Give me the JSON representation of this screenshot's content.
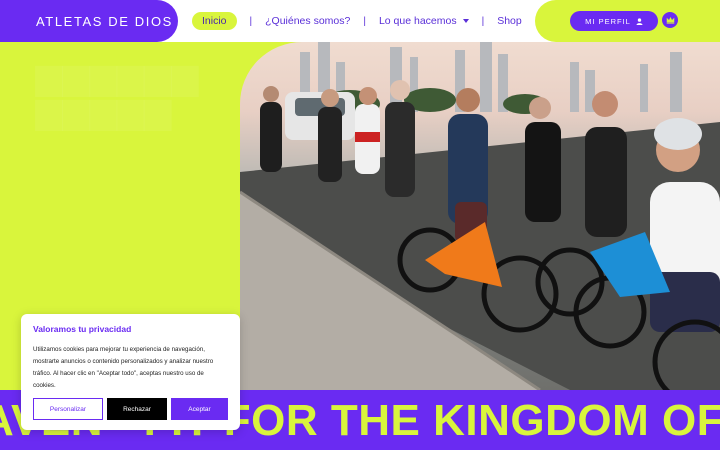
{
  "header": {
    "brand": "ATLETAS DE DIOS",
    "nav": [
      {
        "label": "Inicio",
        "active": true
      },
      {
        "label": "¿Quiénes somos?"
      },
      {
        "label": "Lo que hacemos",
        "has_dropdown": true
      },
      {
        "label": "Shop"
      }
    ],
    "profile_label": "MI PERFIL",
    "profile_icon": "user-icon",
    "crown_icon": "crown-icon"
  },
  "hero": {
    "image_alt": "Group of cyclists posing with road bikes on a coastal road"
  },
  "marquee": {
    "text": "AVEN · FIT FOR THE KINGDOM OF HEAVEN · FIT FOR THE KINGDOM OF HEAVEN"
  },
  "cookie_banner": {
    "title": "Valoramos tu privacidad",
    "body": "Utilizamos cookies para mejorar tu experiencia de navegación, mostrarte anuncios o contenido personalizados y analizar nuestro tráfico. Al hacer clic en \"Aceptar todo\", aceptas nuestro uso de cookies.",
    "customize_label": "Personalizar",
    "reject_label": "Rechazar",
    "accept_label": "Aceptar"
  },
  "colors": {
    "brand_purple": "#6a2bf2",
    "lime": "#d9f53c",
    "white": "#ffffff"
  }
}
